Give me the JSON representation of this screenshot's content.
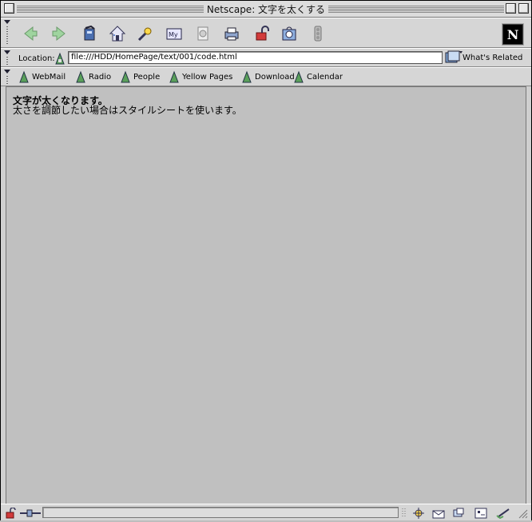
{
  "window": {
    "title": "Netscape: 文字を太くする"
  },
  "toolbar": {
    "buttons": [
      "back-icon",
      "forward-icon",
      "reload-icon",
      "home-icon",
      "search-icon",
      "my-netscape-icon",
      "images-icon",
      "print-icon",
      "security-icon",
      "shop-icon",
      "stop-icon"
    ],
    "logo": "N"
  },
  "location": {
    "label": "Location:",
    "url": "file:///HDD/HomePage/text/001/code.html",
    "related_label": "What's Related"
  },
  "personal": [
    "WebMail",
    "Radio",
    "People",
    "Yellow Pages",
    "Download",
    "Calendar"
  ],
  "page": {
    "heading": "文字が太くなります。",
    "text": "太さを調節したい場合はスタイルシートを使います。"
  }
}
